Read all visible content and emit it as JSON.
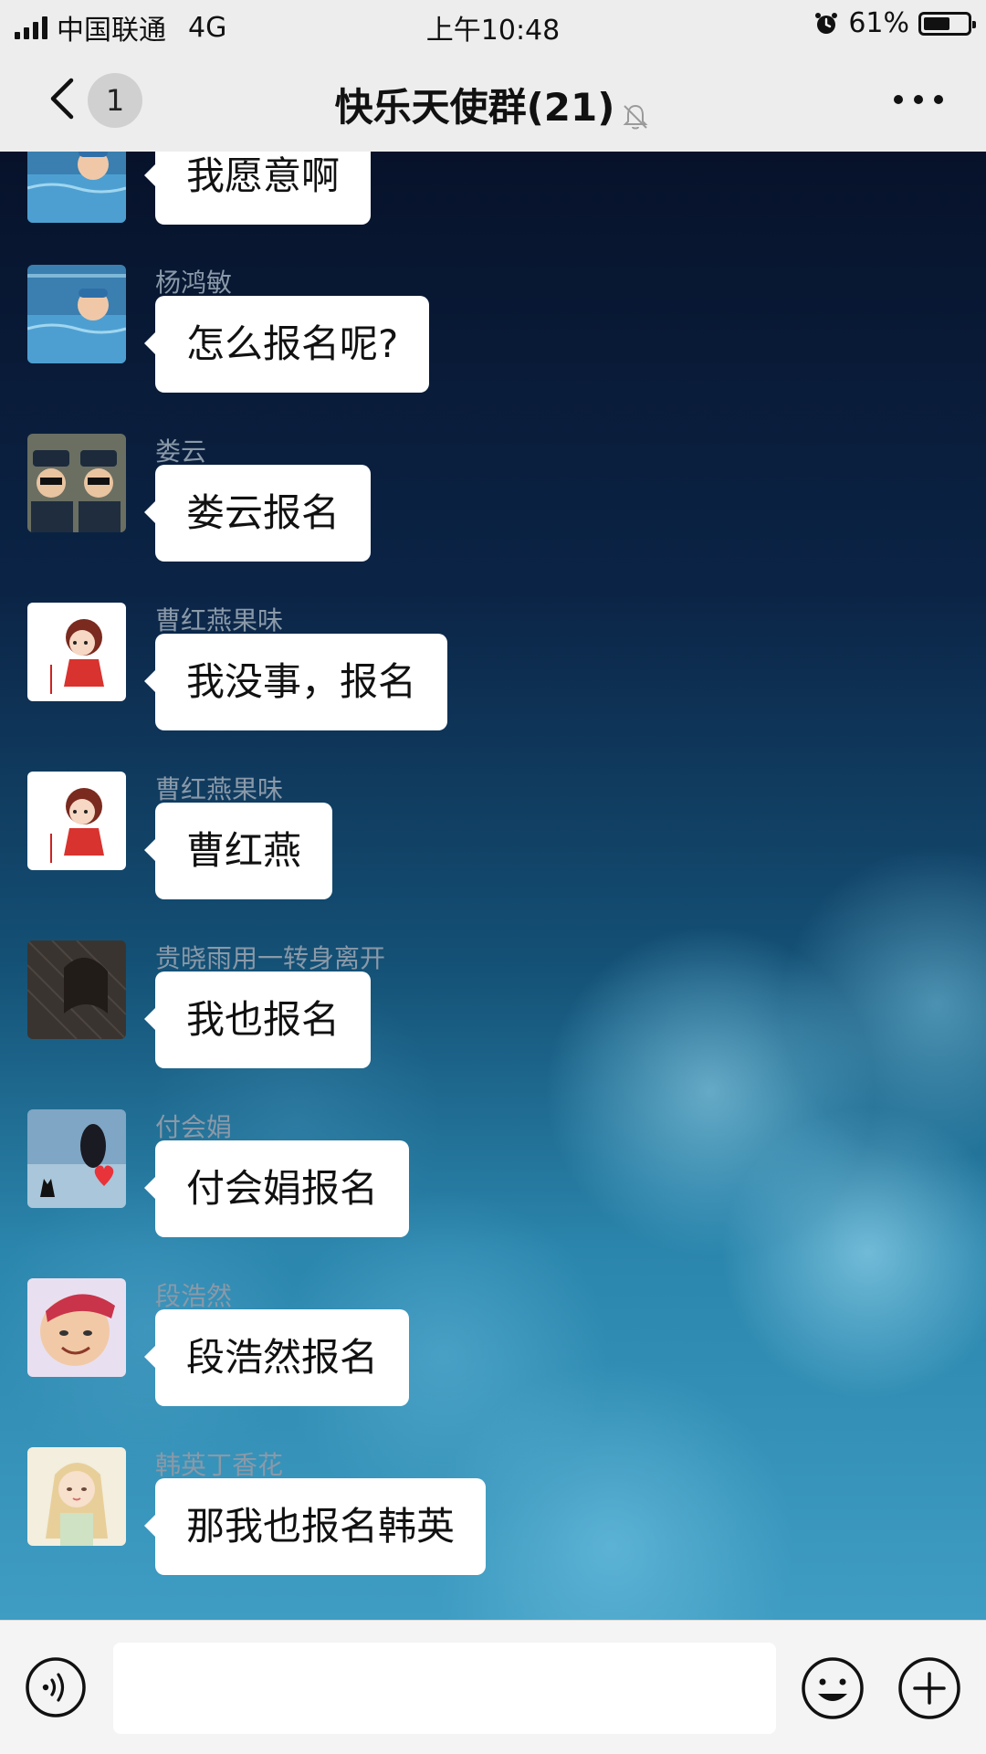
{
  "status_bar": {
    "carrier": "中国联通",
    "network": "4G",
    "time": "上午10:48",
    "battery_percent_text": "61%",
    "battery_level": 0.61,
    "icons": [
      "signal-icon",
      "alarm-icon",
      "battery-icon"
    ]
  },
  "nav": {
    "back_icon": "chevron-left-icon",
    "unread_count": "1",
    "title": "快乐天使群(21)",
    "mute_icon": "bell-muted-icon",
    "more_icon": "more-dots-icon"
  },
  "messages": [
    {
      "sender": "",
      "text": "我愿意啊",
      "avatar": "swimming-child"
    },
    {
      "sender": "杨鸿敏",
      "text": "怎么报名呢?",
      "avatar": "swimming-child"
    },
    {
      "sender": "娄云",
      "text": "娄云报名",
      "avatar": "police-kids"
    },
    {
      "sender": "曹红燕果味",
      "text": "我没事，报名",
      "avatar": "cartoon-girl"
    },
    {
      "sender": "曹红燕果味",
      "text": "曹红燕",
      "avatar": "cartoon-girl"
    },
    {
      "sender": "贵晓雨用一转身离开",
      "text": "我也报名",
      "avatar": "woman-portrait"
    },
    {
      "sender": "付会娟",
      "text": "付会娟报名",
      "avatar": "silhouette-heart"
    },
    {
      "sender": "段浩然",
      "text": "段浩然报名",
      "avatar": "child-red-hat"
    },
    {
      "sender": "韩英丁香花",
      "text": "那我也报名韩英",
      "avatar": "illustrated-girl"
    }
  ],
  "input_bar": {
    "voice_icon": "voice-icon",
    "input_value": "",
    "emoji_icon": "emoji-icon",
    "plus_icon": "plus-icon"
  },
  "colors": {
    "bar_background": "#ededed",
    "bubble": "#ffffff",
    "sender_name": "#8a99a8"
  }
}
